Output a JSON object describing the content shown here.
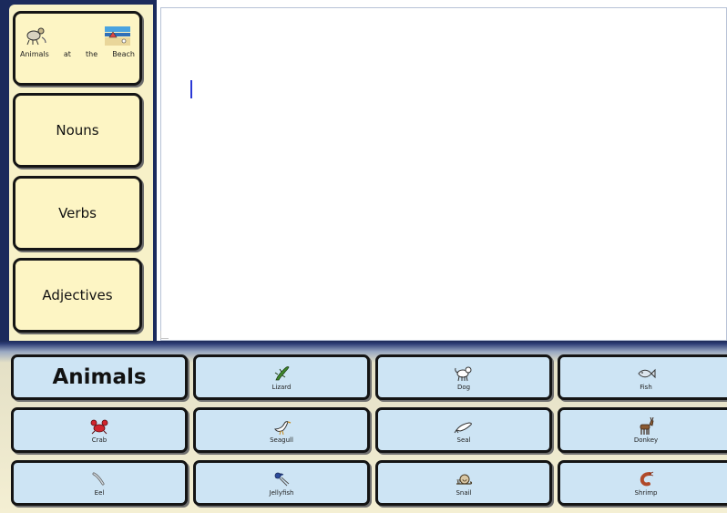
{
  "left_panel": {
    "buttons": [
      {
        "label": "Animals at the Beach",
        "caption": [
          "Animals",
          "at",
          "the",
          "Beach"
        ]
      },
      {
        "label": "Nouns"
      },
      {
        "label": "Verbs"
      },
      {
        "label": "Adjectives"
      }
    ]
  },
  "text_area": {
    "value": ""
  },
  "grid": {
    "category": "Animals",
    "items": [
      {
        "label": "Lizard",
        "icon": "lizard-icon"
      },
      {
        "label": "Dog",
        "icon": "dog-icon"
      },
      {
        "label": "Fish",
        "icon": "fish-icon"
      },
      {
        "label": "Crab",
        "icon": "crab-icon"
      },
      {
        "label": "Seagull",
        "icon": "seagull-icon"
      },
      {
        "label": "Seal",
        "icon": "seal-icon"
      },
      {
        "label": "Donkey",
        "icon": "donkey-icon"
      },
      {
        "label": "Eel",
        "icon": "eel-icon"
      },
      {
        "label": "Jellyfish",
        "icon": "jellyfish-icon"
      },
      {
        "label": "Snail",
        "icon": "snail-icon"
      },
      {
        "label": "Shrimp",
        "icon": "shrimp-icon"
      }
    ]
  },
  "colors": {
    "navy": "#1b2a5c",
    "category_button": "#fdf5c4",
    "grid_button": "#cde4f4",
    "cursor": "#2b39d6"
  }
}
